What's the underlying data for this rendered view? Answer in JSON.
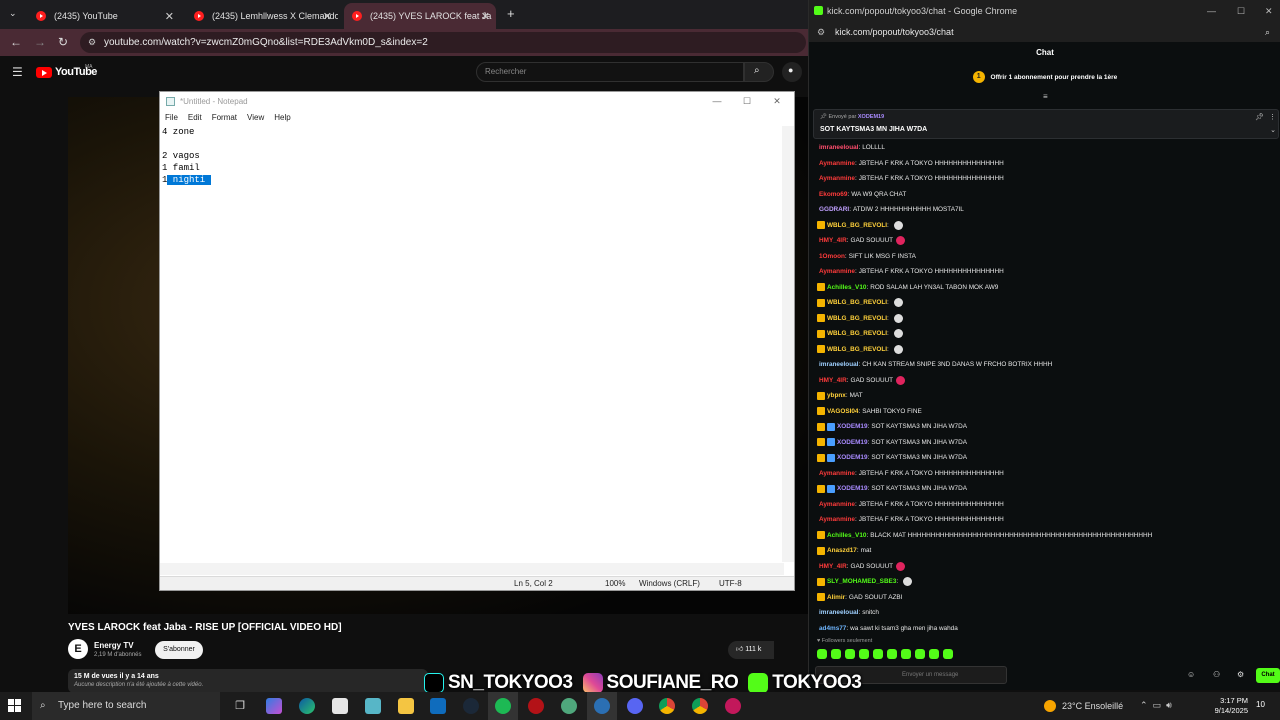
{
  "browser_left": {
    "tabs": [
      {
        "label": "(2435) YouTube"
      },
      {
        "label": "(2435) Lemhllwess X Clemando"
      },
      {
        "label": "(2435) YVES LAROCK feat Ja"
      }
    ],
    "url": "youtube.com/watch?v=zwcmZ0mGQno&list=RDE3AdVkm0D_s&index=2"
  },
  "youtube": {
    "logo_text": "YouTube",
    "country": "MA",
    "search_placeholder": "Rechercher",
    "video_title": "YVES LAROCK feat Jaba - RISE UP [OFFICIAL VIDEO HD]",
    "channel_avatar": "E",
    "channel_name": "Energy TV",
    "channel_subs": "2,19 M d'abonnés",
    "subscribe_label": "S'abonner",
    "likes": "111 k",
    "views_line": "15 M de vues  il y a 14 ans",
    "description": "Aucune description n'a été ajoutée à cette vidéo."
  },
  "notepad": {
    "title": "*Untitled - Notepad",
    "menu": [
      "File",
      "Edit",
      "Format",
      "View",
      "Help"
    ],
    "lines": [
      "4 zone",
      "",
      "2 vagos",
      "1 famil"
    ],
    "last_line_prefix": "1",
    "selected_text": " nighti ",
    "status": {
      "position": "Ln 5, Col 2",
      "zoom": "100%",
      "line_ending": "Windows (CRLF)",
      "encoding": "UTF-8"
    }
  },
  "browser_right": {
    "window_title": "kick.com/popout/tokyoo3/chat - Google Chrome",
    "url": "kick.com/popout/tokyoo3/chat"
  },
  "chat": {
    "header": "Chat",
    "sub_offer_count": "1",
    "sub_offer": "Offrir 1 abonnement pour prendre la 1ère",
    "pinned_sender_label": "Envoyé par",
    "pinned_sender": "XODEM19",
    "pinned_message": "SOT KAYTSMA3 MN JIHA W7DA",
    "messages": [
      {
        "user": "imraneeloual",
        "text": "LOLLLL",
        "color": "#ff4d6d"
      },
      {
        "user": "Aymanmine",
        "text": "JBTEHA F KRK A TOKYO HHHHHHHHHHHHHHH",
        "color": "#ff3b3b"
      },
      {
        "user": "Aymanmine",
        "text": "JBTEHA F KRK A TOKYO HHHHHHHHHHHHHHH",
        "color": "#ff3b3b"
      },
      {
        "user": "Ekomo69",
        "text": "WA W9 QRA CHAT",
        "color": "#ff3b3b"
      },
      {
        "user": "GGDRARI",
        "text": "ATDIW 2 HHHHHHHHHHH MOSTA7IL",
        "color": "#c0a0ff"
      },
      {
        "user": "WBLG_BG_REVOLI",
        "text": "",
        "color": "#ffd13b"
      },
      {
        "user": "HMY_4IR",
        "text": "GAD SOUUUT",
        "color": "#ff3b3b"
      },
      {
        "user": "1Omoon",
        "text": "SIFT LIK MSG F INSTA",
        "color": "#ff3b3b"
      },
      {
        "user": "Aymanmine",
        "text": "JBTEHA F KRK A TOKYO HHHHHHHHHHHHHHH",
        "color": "#ff3b3b"
      },
      {
        "user": "Achilles_V10",
        "text": "ROD SALAM LAH YN3AL TABON MOK AW9",
        "color": "#53fc18"
      },
      {
        "user": "WBLG_BG_REVOLI",
        "text": "",
        "color": "#ffd13b"
      },
      {
        "user": "WBLG_BG_REVOLI",
        "text": "",
        "color": "#ffd13b"
      },
      {
        "user": "WBLG_BG_REVOLI",
        "text": "",
        "color": "#ffd13b"
      },
      {
        "user": "WBLG_BG_REVOLI",
        "text": "",
        "color": "#ffd13b"
      },
      {
        "user": "imraneeloual",
        "text": "CH KAN STREAM SNIPE 3ND DANAS W FRCHO BOTRIX HHHH",
        "color": "#9fd0ff"
      },
      {
        "user": "HMY_4IR",
        "text": "GAD SOUUUT",
        "color": "#ff3b3b"
      },
      {
        "user": "ybpnx",
        "text": "MAT",
        "color": "#ffd13b"
      },
      {
        "user": "VAGOSI04",
        "text": "SAHBI TOKYO FINE",
        "color": "#ffd13b"
      },
      {
        "user": "XODEM19",
        "text": "SOT KAYTSMA3 MN JIHA W7DA",
        "color": "#a98bff"
      },
      {
        "user": "XODEM19",
        "text": "SOT KAYTSMA3 MN JIHA W7DA",
        "color": "#a98bff"
      },
      {
        "user": "XODEM19",
        "text": "SOT KAYTSMA3 MN JIHA W7DA",
        "color": "#a98bff"
      },
      {
        "user": "Aymanmine",
        "text": "JBTEHA F KRK A TOKYO HHHHHHHHHHHHHHH",
        "color": "#ff3b3b"
      },
      {
        "user": "XODEM19",
        "text": "SOT KAYTSMA3 MN JIHA W7DA",
        "color": "#a98bff"
      },
      {
        "user": "Aymanmine",
        "text": "JBTEHA F KRK A TOKYO HHHHHHHHHHHHHHH",
        "color": "#ff3b3b"
      },
      {
        "user": "Aymanmine",
        "text": "JBTEHA F KRK A TOKYO HHHHHHHHHHHHHHH",
        "color": "#ff3b3b"
      },
      {
        "user": "Achilles_V10",
        "text": "BLACK MAT HHHHHHHHHHHHHHHHHHHHHHHHHHHHHHHHHHHHHHHHHHHHHHHHHHHHH",
        "color": "#53fc18"
      },
      {
        "user": "Anaszd17",
        "text": "mat",
        "color": "#ffd13b"
      },
      {
        "user": "HMY_4IR",
        "text": "GAD SOUUUT",
        "color": "#ff3b3b"
      },
      {
        "user": "SLY_MOHAMED_SBE3",
        "text": "",
        "color": "#53fc18"
      },
      {
        "user": "Alimir",
        "text": "GAD SOUUT AZBI",
        "color": "#ffd13b"
      },
      {
        "user": "imraneeloual",
        "text": "snitch",
        "color": "#9fd0ff"
      },
      {
        "user": "ad4ms77",
        "text": "wa sawt ki tsam3 gha men jiha wahda",
        "color": "#6fb6ff"
      }
    ],
    "followers_only": "Followers seulement",
    "input_placeholder": "Envoyer un message",
    "send_label": "Chat"
  },
  "overlay": {
    "tiktok": "SN_TOKYOO3",
    "instagram": "SOUFIANE_RO",
    "kick": "TOKYOO3"
  },
  "taskbar": {
    "search_placeholder": "Type here to search",
    "weather": "23°C  Ensoleillé",
    "time": "3:17 PM",
    "date": "9/14/2025",
    "notif_count": "10"
  }
}
